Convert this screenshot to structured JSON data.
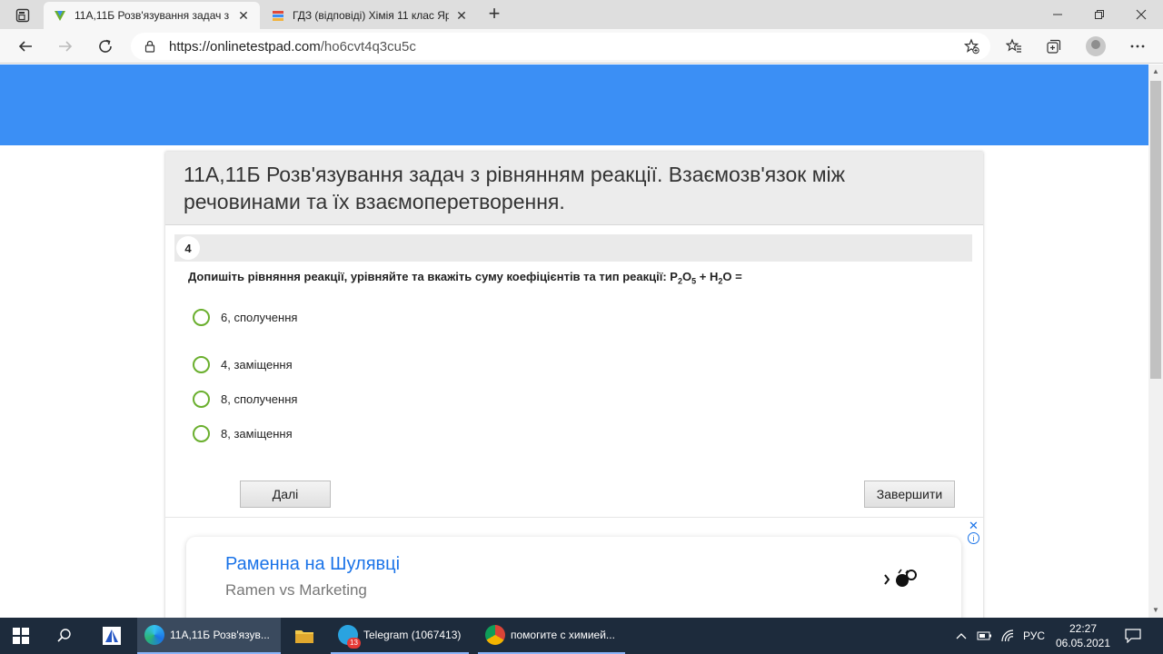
{
  "browser": {
    "tabs": [
      {
        "title": "11А,11Б Розв'язування задач з р",
        "active": true
      },
      {
        "title": "ГДЗ (відповіді) Хімія 11 клас Яр",
        "active": false
      }
    ],
    "new_tab": "+",
    "close_glyph": "✕",
    "url_host": "https://onlinetestpad.com",
    "url_path": "/ho6cvt4q3cu5c"
  },
  "page": {
    "test_title": "11А,11Б Розв'язування задач з рівнянням реакції. Взаємозв'язок між речовинами та їх взаємоперетворення.",
    "question_number": "4",
    "question": {
      "prefix": "Допишіть рівняння реакції, урівняйте та вкажіть суму коефіцієнтів та тип реакції: P",
      "s1": "2",
      "t1": "O",
      "s2": "5",
      "t2": " + H",
      "s3": "2",
      "t3": "O ="
    },
    "options": [
      {
        "label": "6, сполучення"
      },
      {
        "label": "4, заміщення"
      },
      {
        "label": "8, сполучення"
      },
      {
        "label": "8, заміщення"
      }
    ],
    "next_button": "Далі",
    "finish_button": "Завершити"
  },
  "ad": {
    "title": "Раменна на Шулявці",
    "subtitle": "Ramen vs Marketing",
    "close": "✕",
    "info": "i"
  },
  "taskbar": {
    "apps": [
      {
        "label": "11А,11Б Розв'язув..."
      },
      {
        "label": "Telegram (1067413)"
      },
      {
        "label": "помогите с химией..."
      }
    ],
    "telegram_badge": "13",
    "lang": "РУС",
    "time": "22:27",
    "date": "06.05.2021"
  },
  "colors": {
    "header_blue": "#3b8ff5",
    "radio_green": "#6aaf2e",
    "ad_link_blue": "#1a73e8",
    "taskbar_bg": "#1d2b3c"
  }
}
